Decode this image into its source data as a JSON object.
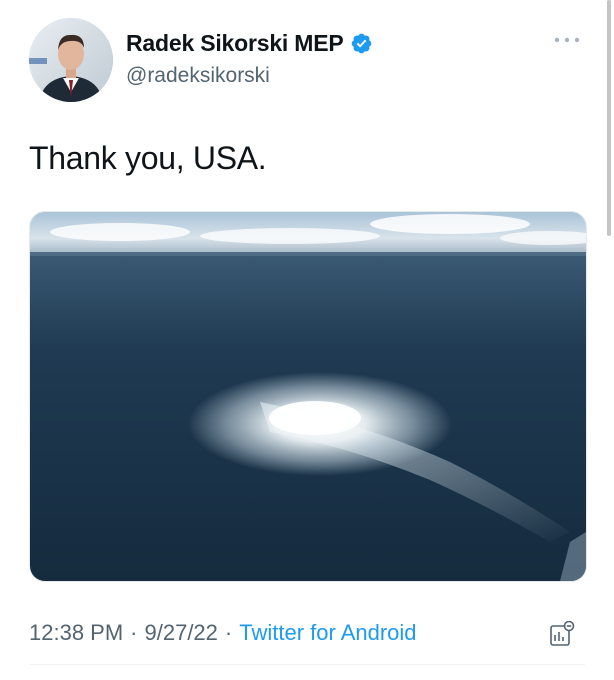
{
  "author": {
    "display_name": "Radek Sikorski MEP",
    "handle": "@radeksikorski",
    "verified_icon": "verified-badge-icon",
    "avatar_icon": "profile-photo"
  },
  "tweet": {
    "text": "Thank you, USA.",
    "media_description": "aerial-sea-gas-leak-photo"
  },
  "meta": {
    "time": "12:38 PM",
    "separator": "·",
    "date": "9/27/22",
    "source": "Twitter for Android"
  },
  "icons": {
    "more": "more-options-icon",
    "analytics": "analytics-icon"
  },
  "colors": {
    "link": "#1d9bf0",
    "secondary_text": "#536471",
    "primary_text": "#0f1419",
    "verified": "#1d9bf0"
  }
}
